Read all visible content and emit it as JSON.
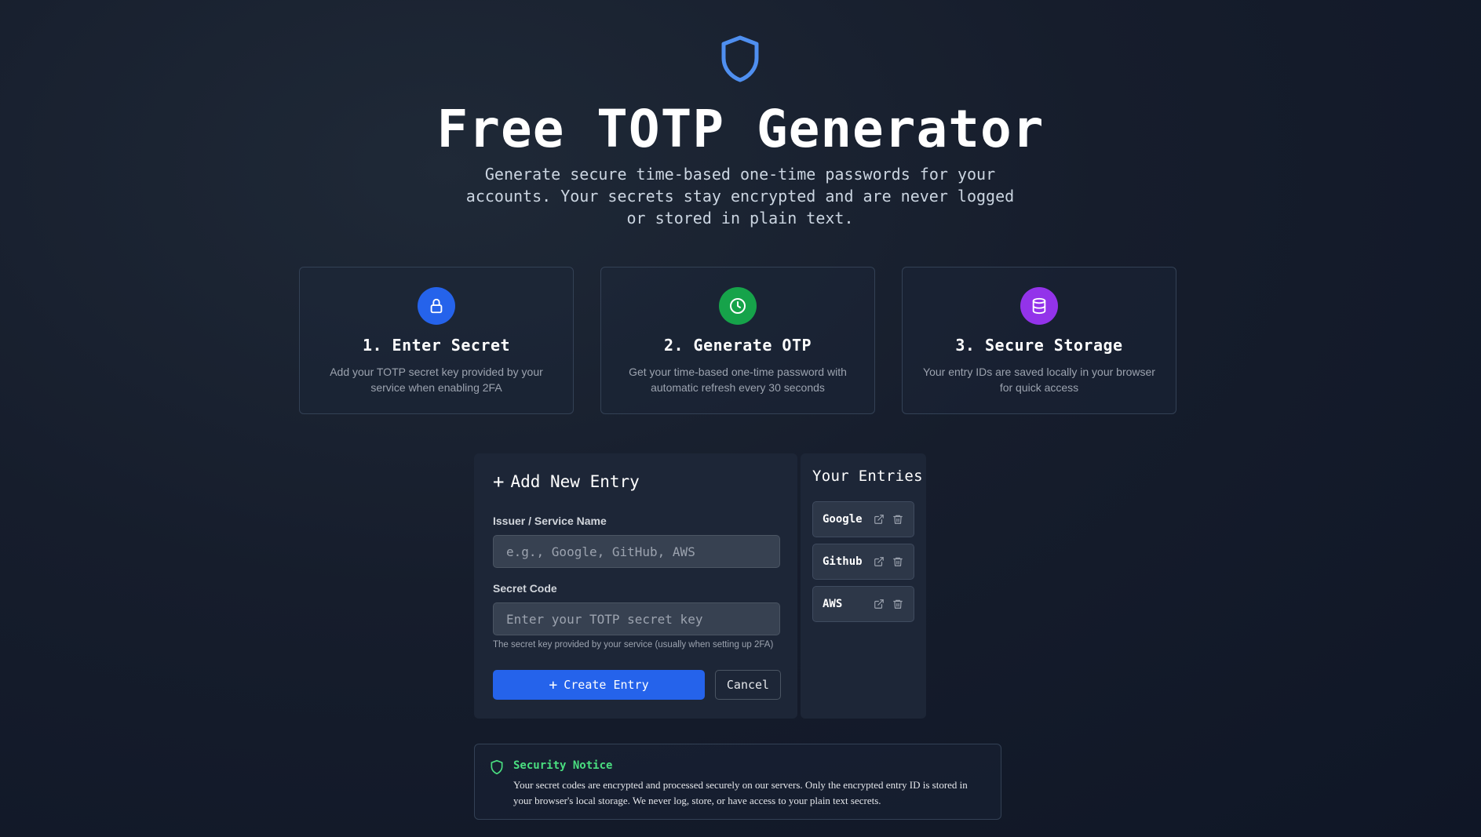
{
  "header": {
    "icon": "shield-icon",
    "title": "Free TOTP Generator",
    "subtitle": "Generate secure time-based one-time passwords for your accounts. Your secrets stay encrypted and are never logged or stored in plain text."
  },
  "steps": [
    {
      "icon": "lock-icon",
      "color": "#2563eb",
      "title": "1. Enter Secret",
      "description": "Add your TOTP secret key provided by your service when enabling 2FA"
    },
    {
      "icon": "clock-icon",
      "color": "#16a34a",
      "title": "2. Generate OTP",
      "description": "Get your time-based one-time password with automatic refresh every 30 seconds"
    },
    {
      "icon": "database-icon",
      "color": "#9333ea",
      "title": "3. Secure Storage",
      "description": "Your entry IDs are saved locally in your browser for quick access"
    }
  ],
  "form": {
    "heading": "Add New Entry",
    "issuer_label": "Issuer / Service Name",
    "issuer_placeholder": "e.g., Google, GitHub, AWS",
    "issuer_value": "",
    "secret_label": "Secret Code",
    "secret_placeholder": "Enter your TOTP secret key",
    "secret_value": "",
    "secret_hint": "The secret key provided by your service (usually when setting up 2FA)",
    "create_label": "Create Entry",
    "cancel_label": "Cancel"
  },
  "entries": {
    "heading": "Your Entries",
    "items": [
      {
        "name": "Google"
      },
      {
        "name": "Github"
      },
      {
        "name": "AWS"
      }
    ]
  },
  "notice": {
    "icon": "shield-icon",
    "title": "Security Notice",
    "text": "Your secret codes are encrypted and processed securely on our servers. Only the encrypted entry ID is stored in your browser's local storage. We never log, store, or have access to your plain text secrets."
  },
  "colors": {
    "accent": "#2563eb",
    "shield": "#4f8ff0",
    "success": "#4ade80",
    "step_blue": "#2563eb",
    "step_green": "#16a34a",
    "step_purple": "#9333ea"
  }
}
